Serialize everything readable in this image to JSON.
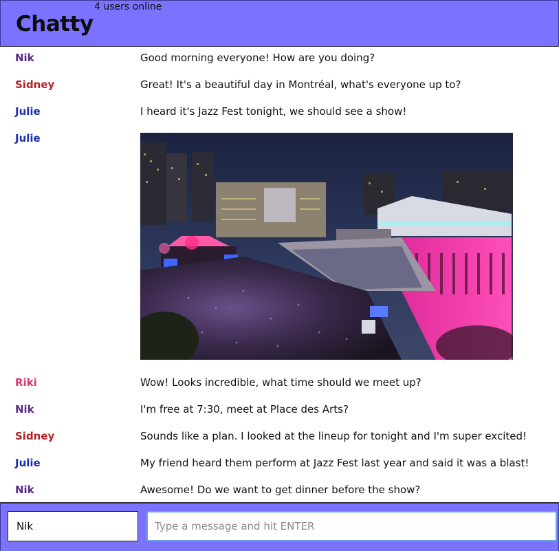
{
  "navbar": {
    "brand": "Chatty",
    "online_count": "4 users online"
  },
  "colors": {
    "navbar_bg": "#7b72ff",
    "Nik": "#5b2a86",
    "Sidney": "#b22222",
    "Julie": "#1f2fb0",
    "Riki": "#d63a73"
  },
  "messages": [
    {
      "username": "Nik",
      "content": "Good morning everyone! How are you doing?"
    },
    {
      "username": "Sidney",
      "content": "Great! It's a beautiful day in Montréal, what's everyone up to?"
    },
    {
      "username": "Julie",
      "content": "I heard it's Jazz Fest tonight, we should see a show!"
    },
    {
      "username": "Julie",
      "image": "Jazz Fest concert crowd at night in Montréal"
    },
    {
      "username": "Riki",
      "content": "Wow! Looks incredible, what time should we meet up?"
    },
    {
      "username": "Nik",
      "content": "I'm free at 7:30, meet at Place des Arts?"
    },
    {
      "username": "Sidney",
      "content": "Sounds like a plan. I looked at the lineup for tonight and I'm super excited!"
    },
    {
      "username": "Julie",
      "content": "My friend heard them perform at Jazz Fest last year and said it was a blast!"
    },
    {
      "username": "Nik",
      "content": "Awesome! Do we want to get dinner before the show?"
    }
  ],
  "composer": {
    "username_value": "Nik",
    "message_placeholder": "Type a message and hit ENTER"
  }
}
